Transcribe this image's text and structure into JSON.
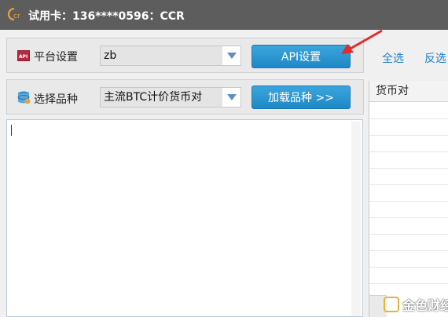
{
  "titlebar": {
    "title": "试用卡：136****0596：CCR",
    "logo_text": "Ccr"
  },
  "platform_row": {
    "icon_text": "API",
    "label": "平台设置",
    "select_value": "zb",
    "api_button": "API设置"
  },
  "top_actions": {
    "select_all": "全选",
    "invert": "反选"
  },
  "variety_row": {
    "label": "选择品种",
    "select_value": "主流BTC计价货币对",
    "load_button": "加载品种 >>"
  },
  "list": {
    "header": "货币对"
  },
  "watermark": {
    "text": "金色财经"
  },
  "colors": {
    "titlebar_bg": "#5d5d5d",
    "accent_button": "#2596d1",
    "link": "#1f7fc7",
    "annotation_arrow": "#e32b2b"
  },
  "icons": [
    "api-icon",
    "database-icon",
    "chevron-down-icon",
    "red-arrow-icon"
  ]
}
